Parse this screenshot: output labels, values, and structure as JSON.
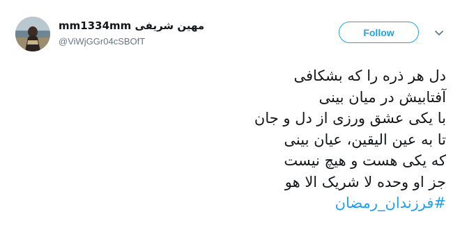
{
  "user": {
    "display_name": "mm1334mm مهین شریفی",
    "handle": "@ViWjGGr04cSBOfT"
  },
  "follow_button": {
    "label": "Follow"
  },
  "menu": {
    "icon": "chevron-down-icon"
  },
  "tweet": {
    "lines": [
      "دل هر ذره را که بشکافی",
      "آفتابیش در میان بینی",
      "با یکی عشق ورزی از دل و جان",
      "تا به عین الیقین، عیان بینی",
      "که یکی هست و هیچ نیست",
      "جز او وحده لا شریک الا هو"
    ],
    "hashtag": "#فرزندان_رمضان"
  },
  "colors": {
    "accent": "#1da1f2",
    "text": "#14171a",
    "muted": "#657786"
  }
}
